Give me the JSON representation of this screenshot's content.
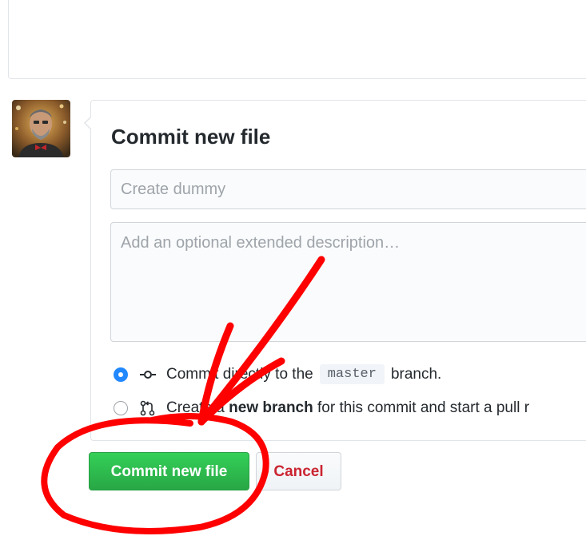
{
  "commit_form": {
    "title": "Commit new file",
    "summary_placeholder": "Create dummy",
    "description_placeholder": "Add an optional extended description…",
    "option_direct": {
      "prefix": "Commit directly to the",
      "branch": "master",
      "suffix": "branch.",
      "selected": true
    },
    "option_new_branch": {
      "prefix": "Create a",
      "bold": "new branch",
      "suffix": "for this commit and start a pull r",
      "selected": false
    }
  },
  "buttons": {
    "commit_label": "Commit new file",
    "cancel_label": "Cancel"
  },
  "colors": {
    "primary_green": "#2ea44f",
    "radio_blue": "#2188ff",
    "cancel_red": "#cb2431",
    "annotation_red": "#ff0000"
  },
  "icons": {
    "direct_commit": "git-commit-icon",
    "new_branch": "git-pull-request-icon"
  }
}
